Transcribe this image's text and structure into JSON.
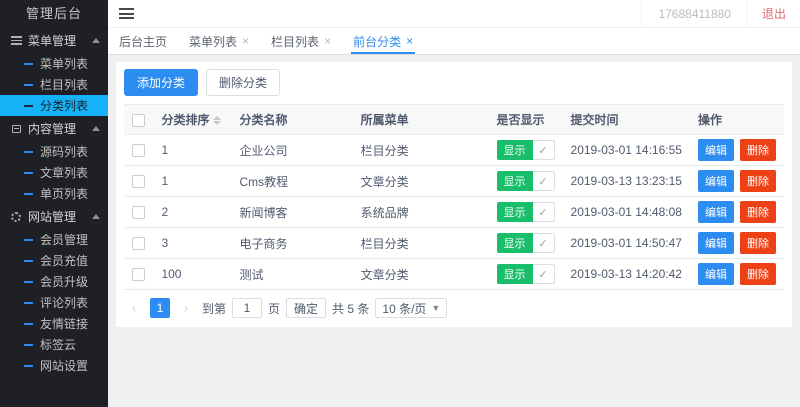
{
  "app": {
    "title": "管理后台",
    "phone": "17688411880",
    "logout": "退出"
  },
  "icons": {
    "close": "×",
    "check": "✓",
    "prev": "‹",
    "next": "›",
    "caret_down": "▼"
  },
  "colors": {
    "primary": "#2d8cf0",
    "success": "#19be6b",
    "danger": "#ed4014",
    "sidebar_bg": "#1e2025",
    "sidebar_active": "#16b2f8",
    "page_bg": "#eef0f2"
  },
  "sidebar": {
    "groups": [
      {
        "label": "菜单管理",
        "icon": "menu-icon",
        "items": [
          {
            "label": "菜单列表"
          },
          {
            "label": "栏目列表"
          },
          {
            "label": "分类列表",
            "active": true
          }
        ]
      },
      {
        "label": "内容管理",
        "icon": "content-icon",
        "items": [
          {
            "label": "源码列表"
          },
          {
            "label": "文章列表"
          },
          {
            "label": "单页列表"
          }
        ]
      },
      {
        "label": "网站管理",
        "icon": "gear-icon",
        "items": [
          {
            "label": "会员管理"
          },
          {
            "label": "会员充值"
          },
          {
            "label": "会员升级"
          },
          {
            "label": "评论列表"
          },
          {
            "label": "友情链接"
          },
          {
            "label": "标签云"
          },
          {
            "label": "网站设置"
          }
        ]
      }
    ]
  },
  "tabs": [
    {
      "label": "后台主页",
      "closable": false,
      "active": false
    },
    {
      "label": "菜单列表",
      "closable": true,
      "active": false
    },
    {
      "label": "栏目列表",
      "closable": true,
      "active": false
    },
    {
      "label": "前台分类",
      "closable": true,
      "active": true
    }
  ],
  "toolbar": {
    "add": "添加分类",
    "delete": "删除分类"
  },
  "table": {
    "headers": {
      "sort": "分类排序",
      "name": "分类名称",
      "menu": "所属菜单",
      "show": "是否显示",
      "time": "提交时间",
      "action": "操作"
    },
    "actions": {
      "edit": "编辑",
      "delete": "删除"
    },
    "rows": [
      {
        "sort": "1",
        "name": "企业公司",
        "menu": "栏目分类",
        "show": "显示",
        "time": "2019-03-01 14:16:55"
      },
      {
        "sort": "1",
        "name": "Cms教程",
        "menu": "文章分类",
        "show": "显示",
        "time": "2019-03-13 13:23:15"
      },
      {
        "sort": "2",
        "name": "新闻博客",
        "menu": "系统品牌",
        "show": "显示",
        "time": "2019-03-01 14:48:08"
      },
      {
        "sort": "3",
        "name": "电子商务",
        "menu": "栏目分类",
        "show": "显示",
        "time": "2019-03-01 14:50:47"
      },
      {
        "sort": "100",
        "name": "测试",
        "menu": "文章分类",
        "show": "显示",
        "time": "2019-03-13 14:20:42"
      }
    ]
  },
  "pagination": {
    "current": "1",
    "goto_label": "到第",
    "page_value": "1",
    "page_unit": "页",
    "confirm": "确定",
    "total": "共 5 条",
    "per_page": "10 条/页"
  }
}
